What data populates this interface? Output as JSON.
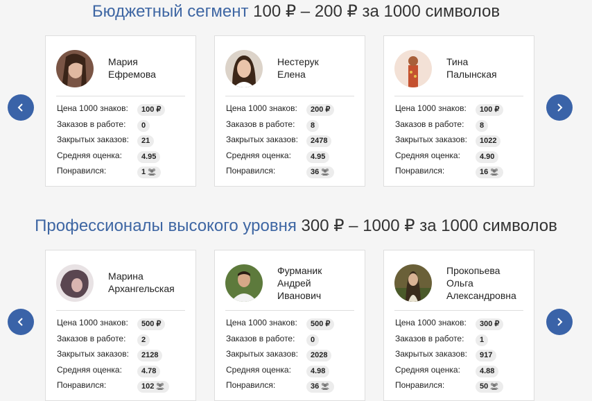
{
  "sections": [
    {
      "title_accent": "Бюджетный сегмент",
      "title_rest": "100 ₽ – 200 ₽ за 1000 символов",
      "cards": [
        {
          "name_lines": [
            "Мария",
            "Ефремова"
          ],
          "price": "100 ₽",
          "in_work": "0",
          "closed": "21",
          "rating": "4.95",
          "liked": "1"
        },
        {
          "name_lines": [
            "Нестерук",
            "Елена"
          ],
          "price": "200 ₽",
          "in_work": "8",
          "closed": "2478",
          "rating": "4.95",
          "liked": "36"
        },
        {
          "name_lines": [
            "Тина",
            "Палынская"
          ],
          "price": "100 ₽",
          "in_work": "8",
          "closed": "1022",
          "rating": "4.90",
          "liked": "16"
        }
      ]
    },
    {
      "title_accent": "Профессионалы высокого уровня",
      "title_rest": "300 ₽ – 1000 ₽ за 1000 символов",
      "cards": [
        {
          "name_lines": [
            "Марина",
            "Архангельская"
          ],
          "price": "500 ₽",
          "in_work": "2",
          "closed": "2128",
          "rating": "4.78",
          "liked": "102"
        },
        {
          "name_lines": [
            "Фурманик",
            "Андрей",
            "Иванович"
          ],
          "price": "500 ₽",
          "in_work": "0",
          "closed": "2028",
          "rating": "4.98",
          "liked": "36"
        },
        {
          "name_lines": [
            "Прокопьева",
            "Ольга",
            "Александровна"
          ],
          "price": "300 ₽",
          "in_work": "1",
          "closed": "917",
          "rating": "4.88",
          "liked": "50"
        }
      ]
    }
  ],
  "labels": {
    "price": "Цена 1000 знаков:",
    "in_work": "Заказов в работе:",
    "closed": "Закрытых заказов:",
    "rating": "Средняя оценка:",
    "liked": "Понравился:"
  },
  "icons": {
    "prev": "chevron-left-icon",
    "next": "chevron-right-icon",
    "liked": "group-icon"
  },
  "colors": {
    "accent": "#3e66a3",
    "arrow": "#3a63a8",
    "badge": "#ececec"
  }
}
